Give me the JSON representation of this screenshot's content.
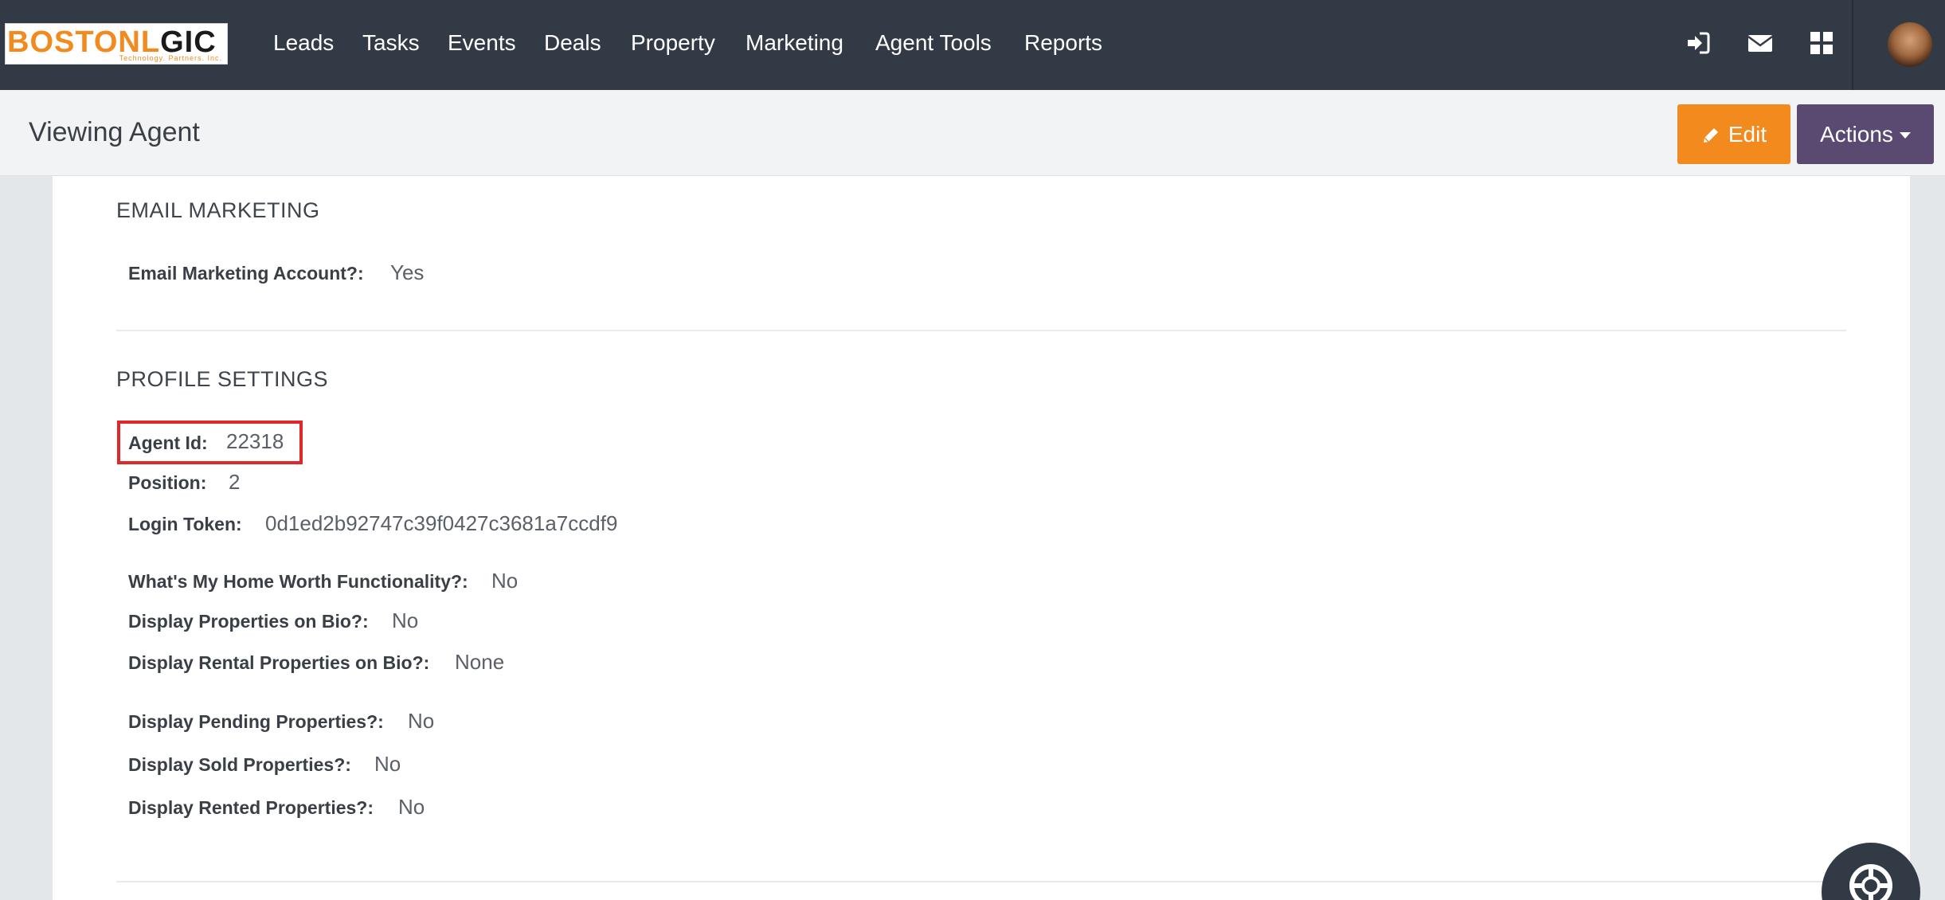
{
  "logo": {
    "text_part1": "BOSTONL",
    "text_part2": "GIC",
    "tagline": "Technology. Partners. Inc."
  },
  "nav": {
    "items": [
      "Leads",
      "Tasks",
      "Events",
      "Deals",
      "Property",
      "Marketing",
      "Agent Tools",
      "Reports"
    ],
    "icons": [
      "sign-in-icon",
      "envelope-icon",
      "grid-icon",
      "avatar"
    ]
  },
  "header": {
    "title": "Viewing Agent",
    "edit_label": "Edit",
    "actions_label": "Actions"
  },
  "sections": {
    "email_marketing": {
      "title": "EMAIL MARKETING",
      "fields": [
        {
          "label": "Email Marketing Account?:",
          "value": "Yes"
        }
      ]
    },
    "profile_settings": {
      "title": "PROFILE SETTINGS",
      "fields": [
        {
          "label": "Agent Id:",
          "value": "22318"
        },
        {
          "label": "Position:",
          "value": "2"
        },
        {
          "label": "Login Token:",
          "value": "0d1ed2b92747c39f0427c3681a7ccdf9"
        },
        {
          "label": "What's My Home Worth Functionality?:",
          "value": "No"
        },
        {
          "label": "Display Properties on Bio?:",
          "value": "No"
        },
        {
          "label": "Display Rental Properties on Bio?:",
          "value": "None"
        },
        {
          "label": "Display Pending Properties?:",
          "value": "No"
        },
        {
          "label": "Display Sold Properties?:",
          "value": "No"
        },
        {
          "label": "Display Rented Properties?:",
          "value": "No"
        }
      ]
    }
  },
  "colors": {
    "navbar": "#323b45",
    "edit_button": "#f28a1e",
    "actions_button": "#5a4a72",
    "highlight": "#e0282a"
  }
}
